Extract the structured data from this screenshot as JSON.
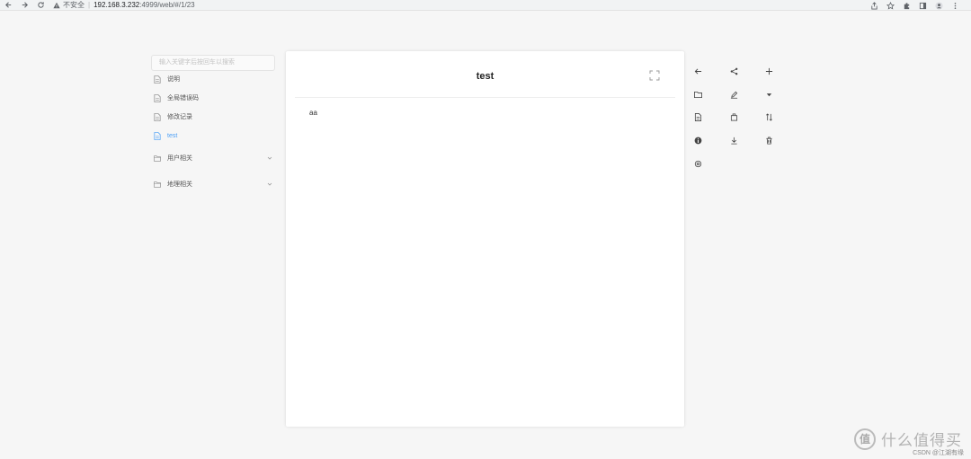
{
  "browser": {
    "security_label": "不安全",
    "url_host": "192.168.3.232",
    "url_path": ":4999/web/#/1/23"
  },
  "sidebar": {
    "search_placeholder": "输入关键字后按回车以搜索",
    "items": [
      {
        "label": "说明",
        "type": "page"
      },
      {
        "label": "全局错误码",
        "type": "page"
      },
      {
        "label": "修改记录",
        "type": "page"
      },
      {
        "label": "test",
        "type": "page",
        "active": true
      },
      {
        "label": "用户相关",
        "type": "folder"
      },
      {
        "label": "地理相关",
        "type": "folder"
      }
    ]
  },
  "page": {
    "title": "test",
    "content": "aa"
  },
  "toolbar": {
    "icons": [
      "back-arrow-icon",
      "share-icon",
      "add-icon",
      "folder-icon",
      "edit-icon",
      "dropdown-icon",
      "file-icon",
      "copy-icon",
      "sort-icon",
      "info-icon",
      "download-icon",
      "delete-icon",
      "settings-icon"
    ]
  },
  "watermark": {
    "logo": "值",
    "text": "什么值得买",
    "note": "CSDN @江湖有缘"
  },
  "colors": {
    "active": "#4a9ef5",
    "background": "#f6f6f6"
  }
}
